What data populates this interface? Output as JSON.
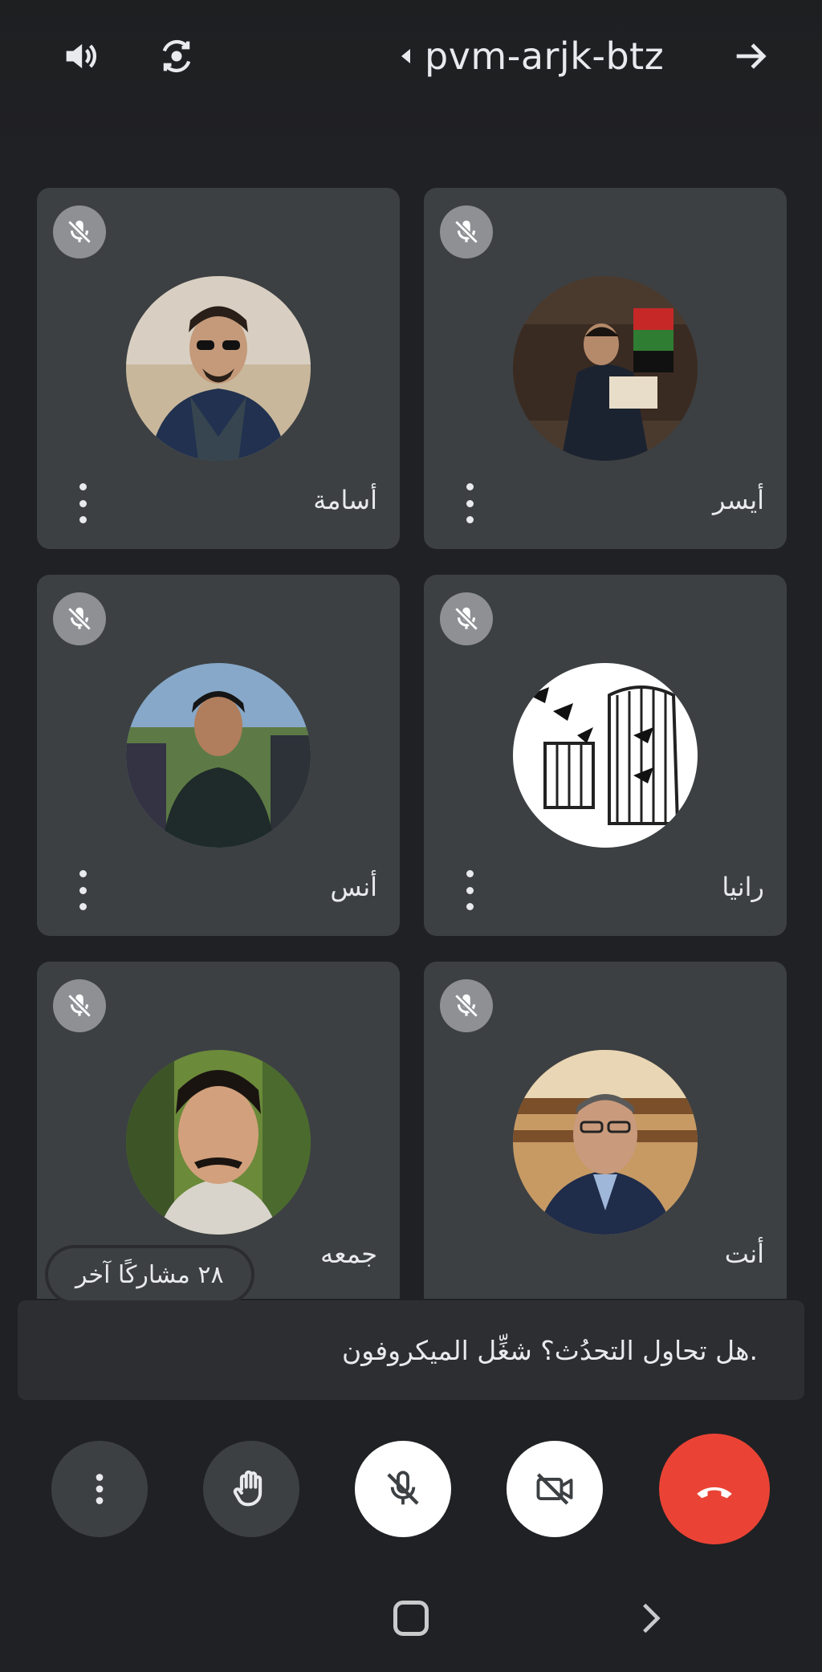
{
  "top_bar": {
    "meeting_code": "pvm-arjk-btz",
    "icons": [
      "speaker-icon",
      "switch-camera-icon",
      "leave-arrow-icon"
    ]
  },
  "participants": [
    {
      "name": "أسامة",
      "muted": true
    },
    {
      "name": "أيسر",
      "muted": true
    },
    {
      "name": "أنس",
      "muted": true
    },
    {
      "name": "رانيا",
      "muted": true
    },
    {
      "name": "جمعه",
      "muted": true
    },
    {
      "name": "أنت",
      "muted": true
    }
  ],
  "others_pill": "٢٨ مشاركًا آخر",
  "notice": "هل تحاول التحدُث؟ شغِّل الميكروفون.",
  "controls": [
    "more-options",
    "raise-hand",
    "microphone-off",
    "camera-off",
    "end-call"
  ],
  "colors": {
    "background": "#202124",
    "tile": "#3c4043",
    "end_call": "#ea4335",
    "text": "#e8eaed"
  }
}
